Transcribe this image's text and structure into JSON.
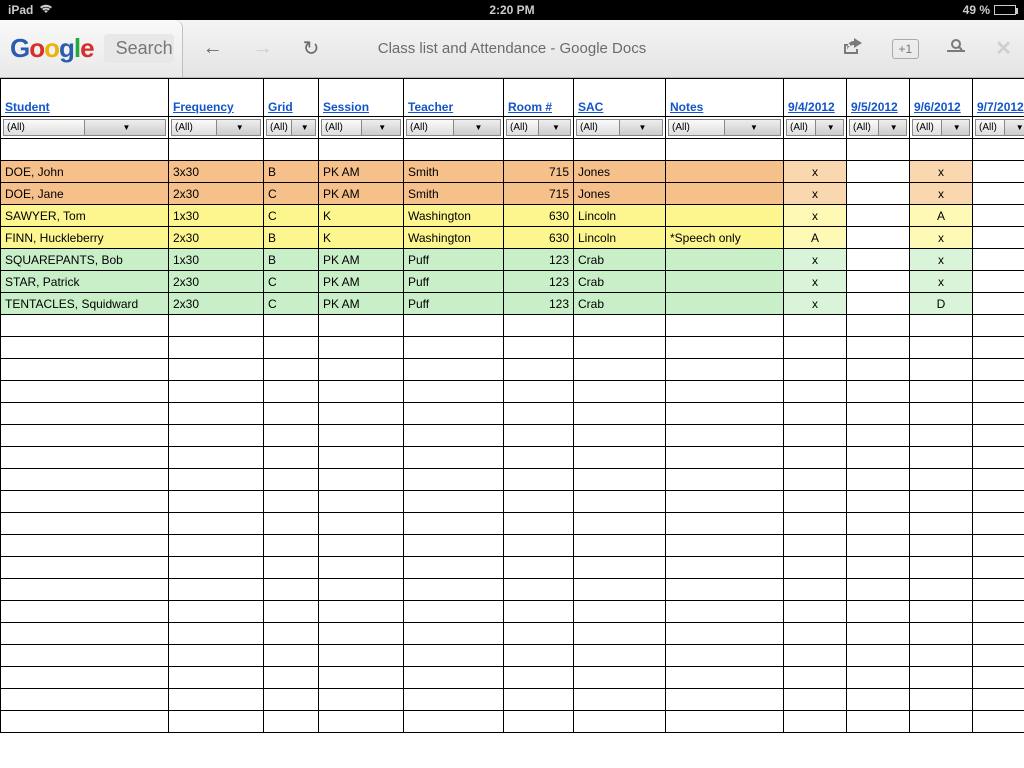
{
  "status": {
    "device": "iPad",
    "time": "2:20 PM",
    "battery_pct": "49 %"
  },
  "browser": {
    "search_placeholder": "Search",
    "title": "Class list and Attendance - Google Docs",
    "plus_one": "+1"
  },
  "headers": [
    "Student",
    "Frequency",
    "Grid",
    "Session",
    "Teacher",
    "Room #",
    "SAC",
    "Notes",
    "9/4/2012",
    "9/5/2012",
    "9/6/2012",
    "9/7/2012"
  ],
  "filter_label": "(All)",
  "rows": [
    {
      "color": "orange",
      "student": "DOE, John",
      "freq": "3x30",
      "grid": "B",
      "session": "PK AM",
      "teacher": "Smith",
      "room": "715",
      "sac": "Jones",
      "notes": "",
      "d1": "x",
      "d2": "",
      "d3": "x",
      "d4": ""
    },
    {
      "color": "orange",
      "student": "DOE, Jane",
      "freq": "2x30",
      "grid": "C",
      "session": "PK AM",
      "teacher": "Smith",
      "room": "715",
      "sac": "Jones",
      "notes": "",
      "d1": "x",
      "d2": "",
      "d3": "x",
      "d4": ""
    },
    {
      "color": "yellow",
      "student": "SAWYER, Tom",
      "freq": "1x30",
      "grid": "C",
      "session": "K",
      "teacher": "Washington",
      "room": "630",
      "sac": "Lincoln",
      "notes": "",
      "d1": "x",
      "d2": "",
      "d3": "A",
      "d4": ""
    },
    {
      "color": "yellow",
      "student": "FINN, Huckleberry",
      "freq": "2x30",
      "grid": "B",
      "session": "K",
      "teacher": "Washington",
      "room": "630",
      "sac": "Lincoln",
      "notes": "*Speech only",
      "d1": "A",
      "d2": "",
      "d3": "x",
      "d4": ""
    },
    {
      "color": "green",
      "student": "SQUAREPANTS, Bob",
      "freq": "1x30",
      "grid": "B",
      "session": "PK AM",
      "teacher": "Puff",
      "room": "123",
      "sac": "Crab",
      "notes": "",
      "d1": "x",
      "d2": "",
      "d3": "x",
      "d4": ""
    },
    {
      "color": "green",
      "student": "STAR, Patrick",
      "freq": "2x30",
      "grid": "C",
      "session": "PK AM",
      "teacher": "Puff",
      "room": "123",
      "sac": "Crab",
      "notes": "",
      "d1": "x",
      "d2": "",
      "d3": "x",
      "d4": ""
    },
    {
      "color": "green",
      "student": "TENTACLES, Squidward",
      "freq": "2x30",
      "grid": "C",
      "session": "PK AM",
      "teacher": "Puff",
      "room": "123",
      "sac": "Crab",
      "notes": "",
      "d1": "x",
      "d2": "",
      "d3": "D",
      "d4": ""
    }
  ],
  "empty_rows": 19
}
